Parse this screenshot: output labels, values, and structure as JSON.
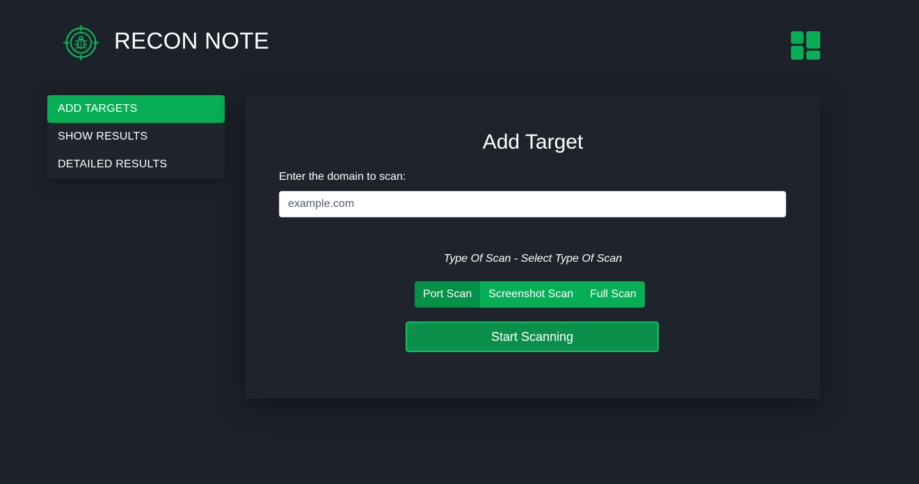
{
  "header": {
    "brand": "RECON NOTE",
    "logo_icon": "target-bug-icon",
    "dashboard_icon": "dashboard-grid-icon"
  },
  "colors": {
    "background": "#1d222a",
    "accent": "#06ae56",
    "accent_dark": "#059147",
    "button": "#0a904b"
  },
  "sidebar": {
    "items": [
      {
        "label": "ADD TARGETS",
        "active": true
      },
      {
        "label": "SHOW RESULTS",
        "active": false
      },
      {
        "label": "DETAILED RESULTS",
        "active": false
      }
    ]
  },
  "main": {
    "title": "Add Target",
    "domain_label": "Enter the domain to scan:",
    "domain_placeholder": "example.com",
    "domain_value": "",
    "scan_type_label": "Type Of Scan - Select Type Of Scan",
    "scan_options": [
      {
        "label": "Port Scan",
        "selected": true
      },
      {
        "label": "Screenshot Scan",
        "selected": false
      },
      {
        "label": "Full Scan",
        "selected": false
      }
    ],
    "start_button": "Start Scanning"
  }
}
